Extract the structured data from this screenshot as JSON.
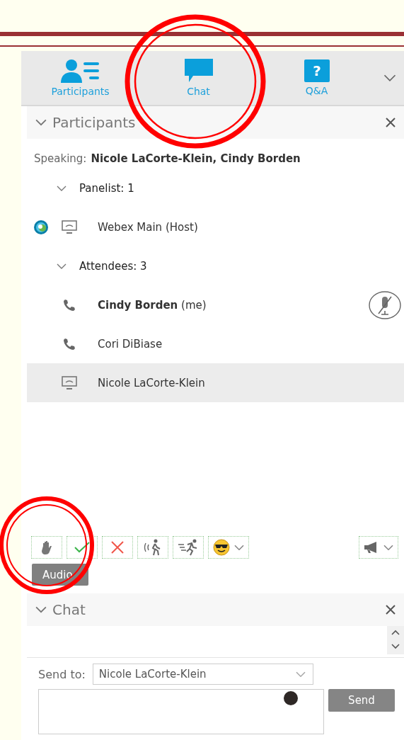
{
  "tabs": [
    {
      "label": "Participants",
      "kind": "people"
    },
    {
      "label": "Chat",
      "kind": "chat"
    },
    {
      "label": "Q&A",
      "kind": "question",
      "icon_text": "?"
    }
  ],
  "participants": {
    "title": "Participants",
    "speaking_label": "Speaking:",
    "speaking_names": "Nicole LaCorte-Klein, Cindy Borden",
    "groups": [
      {
        "label": "Panelist: 1",
        "expanded": true,
        "members": [
          {
            "name": "Webex Main (Host)",
            "kind": "computer",
            "presenter": true,
            "muted": false,
            "selected": false
          }
        ]
      },
      {
        "label": "Attendees: 3",
        "expanded": true,
        "members": [
          {
            "name": "**Cindy Borden** (me)",
            "kind": "phone",
            "presenter": false,
            "muted": true,
            "selected": false
          },
          {
            "name": "Cori DiBiase",
            "kind": "phone",
            "presenter": false,
            "muted": false,
            "selected": false
          },
          {
            "name": "Nicole LaCorte-Klein",
            "kind": "computer",
            "presenter": false,
            "muted": false,
            "selected": true
          }
        ]
      }
    ]
  },
  "reactions": [
    {
      "kind": "hand"
    },
    {
      "kind": "check"
    },
    {
      "kind": "cross"
    },
    {
      "kind": "louder"
    },
    {
      "kind": "faster"
    },
    {
      "kind": "emoji"
    }
  ],
  "tooltip": "Audio",
  "chat": {
    "title": "Chat",
    "send_to_label": "Send to:",
    "recipient": "Nicole LaCorte-Klein",
    "send_button": "Send"
  }
}
